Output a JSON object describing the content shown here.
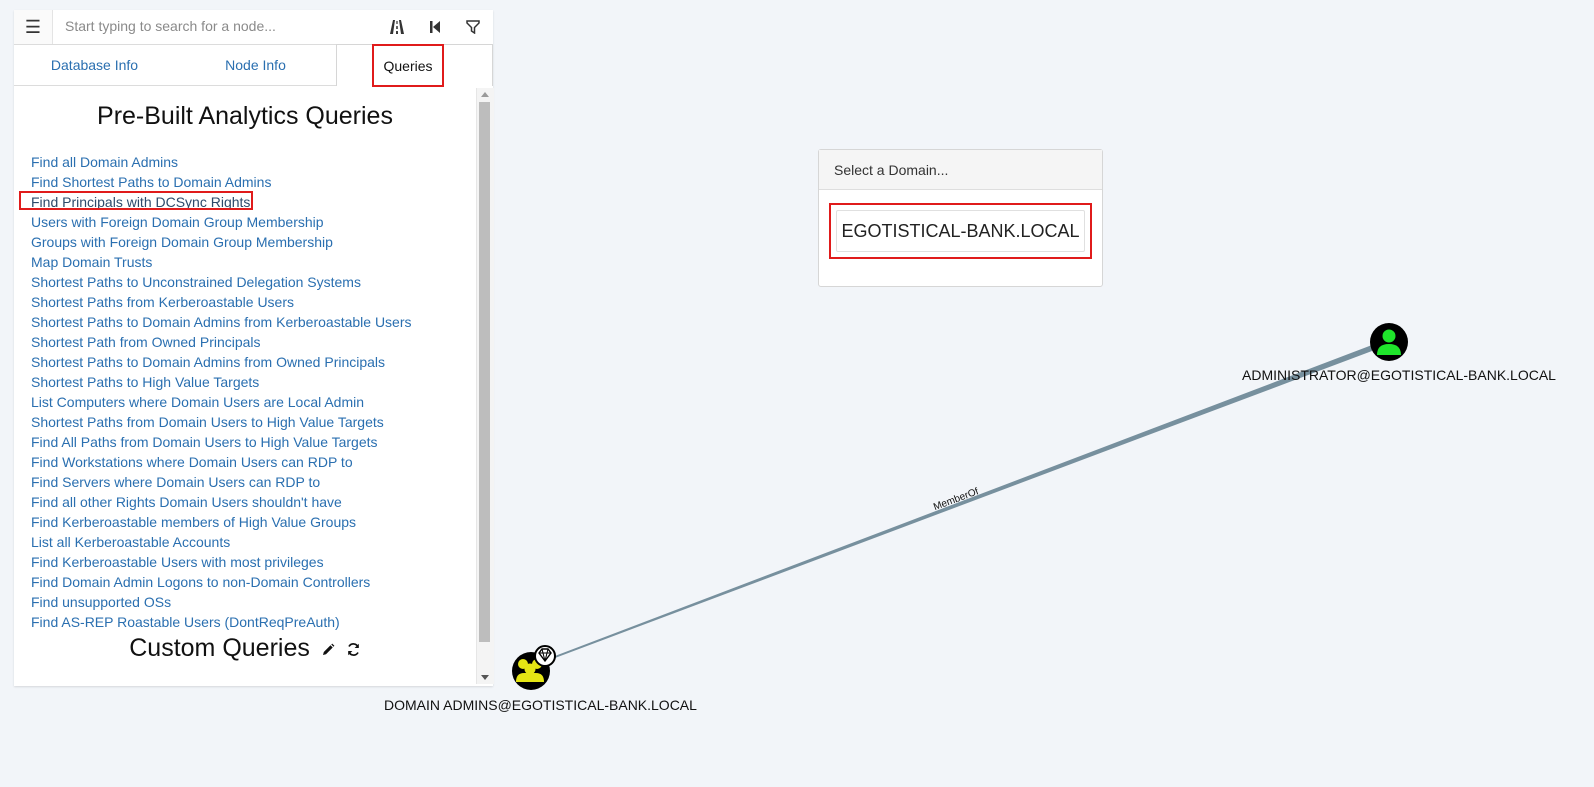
{
  "search": {
    "placeholder": "Start typing to search for a node..."
  },
  "toolbar": {
    "menu_icon": "hamburger-icon",
    "pathfinding_icon": "road-icon",
    "back_icon": "step-backward-icon",
    "filter_icon": "filter-icon"
  },
  "tabs": {
    "database_info": "Database Info",
    "node_info": "Node Info",
    "queries": "Queries",
    "active": "queries"
  },
  "queries_panel": {
    "title": "Pre-Built Analytics Queries",
    "selected_index": 2,
    "items": [
      "Find all Domain Admins",
      "Find Shortest Paths to Domain Admins",
      "Find Principals with DCSync Rights",
      "Users with Foreign Domain Group Membership",
      "Groups with Foreign Domain Group Membership",
      "Map Domain Trusts",
      "Shortest Paths to Unconstrained Delegation Systems",
      "Shortest Paths from Kerberoastable Users",
      "Shortest Paths to Domain Admins from Kerberoastable Users",
      "Shortest Path from Owned Principals",
      "Shortest Paths to Domain Admins from Owned Principals",
      "Shortest Paths to High Value Targets",
      "List Computers where Domain Users are Local Admin",
      "Shortest Paths from Domain Users to High Value Targets",
      "Find All Paths from Domain Users to High Value Targets",
      "Find Workstations where Domain Users can RDP to",
      "Find Servers where Domain Users can RDP to",
      "Find all other Rights Domain Users shouldn't have",
      "Find Kerberoastable members of High Value Groups",
      "List all Kerberoastable Accounts",
      "Find Kerberoastable Users with most privileges",
      "Find Domain Admin Logons to non-Domain Controllers",
      "Find unsupported OSs",
      "Find AS-REP Roastable Users (DontReqPreAuth)"
    ],
    "custom_title": "Custom Queries",
    "custom_icons": [
      "pencil-icon",
      "refresh-icon"
    ]
  },
  "domain_select": {
    "header": "Select a Domain...",
    "option": "EGOTISTICAL-BANK.LOCAL"
  },
  "graph": {
    "nodes": [
      {
        "id": "admin",
        "label": "ADMINISTRATOR@EGOTISTICAL-BANK.LOCAL",
        "type": "User",
        "icon": "user-icon",
        "color": "#1fe62b"
      },
      {
        "id": "domain_admins",
        "label": "DOMAIN ADMINS@EGOTISTICAL-BANK.LOCAL",
        "type": "Group",
        "icon": "users-icon",
        "badge_icon": "gem-icon",
        "color": "#e6e614"
      }
    ],
    "edges": [
      {
        "from": "admin",
        "to": "domain_admins",
        "label": "MemberOf"
      }
    ]
  }
}
